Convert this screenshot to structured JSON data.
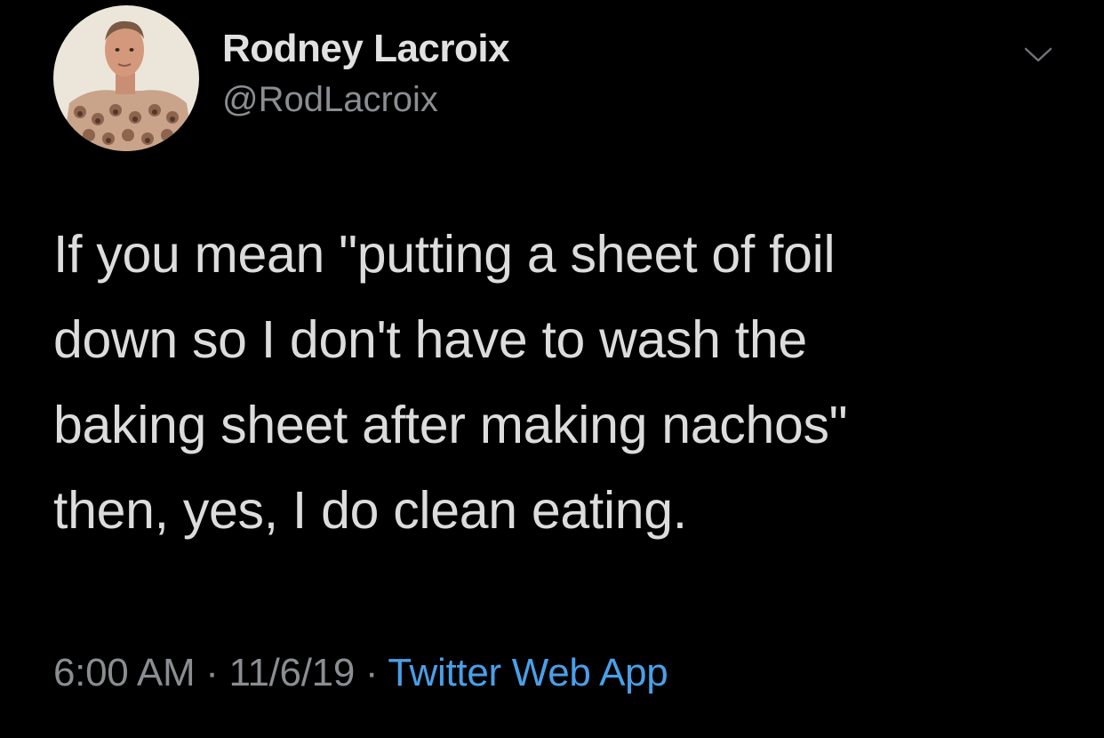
{
  "user": {
    "display_name": "Rodney Lacroix",
    "handle": "@RodLacroix",
    "avatar_icon": "profile-photo"
  },
  "menu": {
    "icon": "chevron-down-icon"
  },
  "tweet": {
    "lines": [
      "If you mean \"putting a sheet of foil",
      "down so I don't have to wash the",
      "baking sheet after making nachos\"",
      "then, yes, I do clean eating."
    ]
  },
  "meta": {
    "time": "6:00 AM",
    "separator_1": " · ",
    "date": "11/6/19",
    "separator_2": " · ",
    "source": "Twitter Web App"
  },
  "colors": {
    "background": "#000000",
    "name": "#e1e1e1",
    "secondary": "#8a8d91",
    "link": "#4a9fe8"
  }
}
